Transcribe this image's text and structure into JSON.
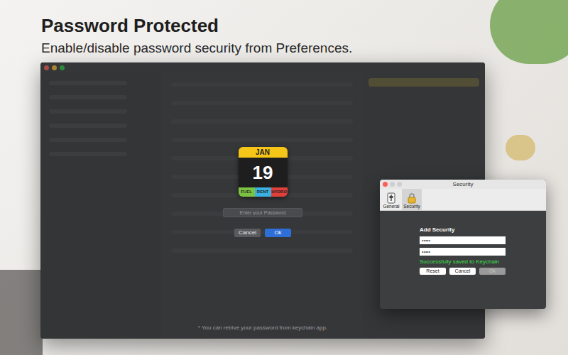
{
  "heading": {
    "title": "Password Protected",
    "subtitle": "Enable/disable password security from Preferences."
  },
  "main_window": {
    "calendar_icon": {
      "month": "JAN",
      "day": "19",
      "tags": [
        {
          "label": "FUEL",
          "color": "#7cc242"
        },
        {
          "label": "RENT",
          "color": "#3ab0e0"
        },
        {
          "label": "HYDRO",
          "color": "#e0403a"
        }
      ]
    },
    "password_field": {
      "placeholder": "Enter your Password"
    },
    "buttons": [
      {
        "label": "Cancel",
        "kind": "secondary"
      },
      {
        "label": "Ok",
        "kind": "primary"
      }
    ],
    "footnote": "* You can retrive your password from keychain app."
  },
  "security_window": {
    "title": "Security",
    "tabs": [
      {
        "label": "General",
        "selected": false
      },
      {
        "label": "Security",
        "selected": true
      }
    ],
    "heading": "Add Security",
    "fields": [
      {
        "value": "•••••"
      },
      {
        "value": "•••••"
      }
    ],
    "status": "Successfully saved to Keychain",
    "buttons": [
      {
        "label": "Reset",
        "disabled": false
      },
      {
        "label": "Cancel",
        "disabled": false
      },
      {
        "label": "Ok",
        "disabled": true
      }
    ]
  }
}
